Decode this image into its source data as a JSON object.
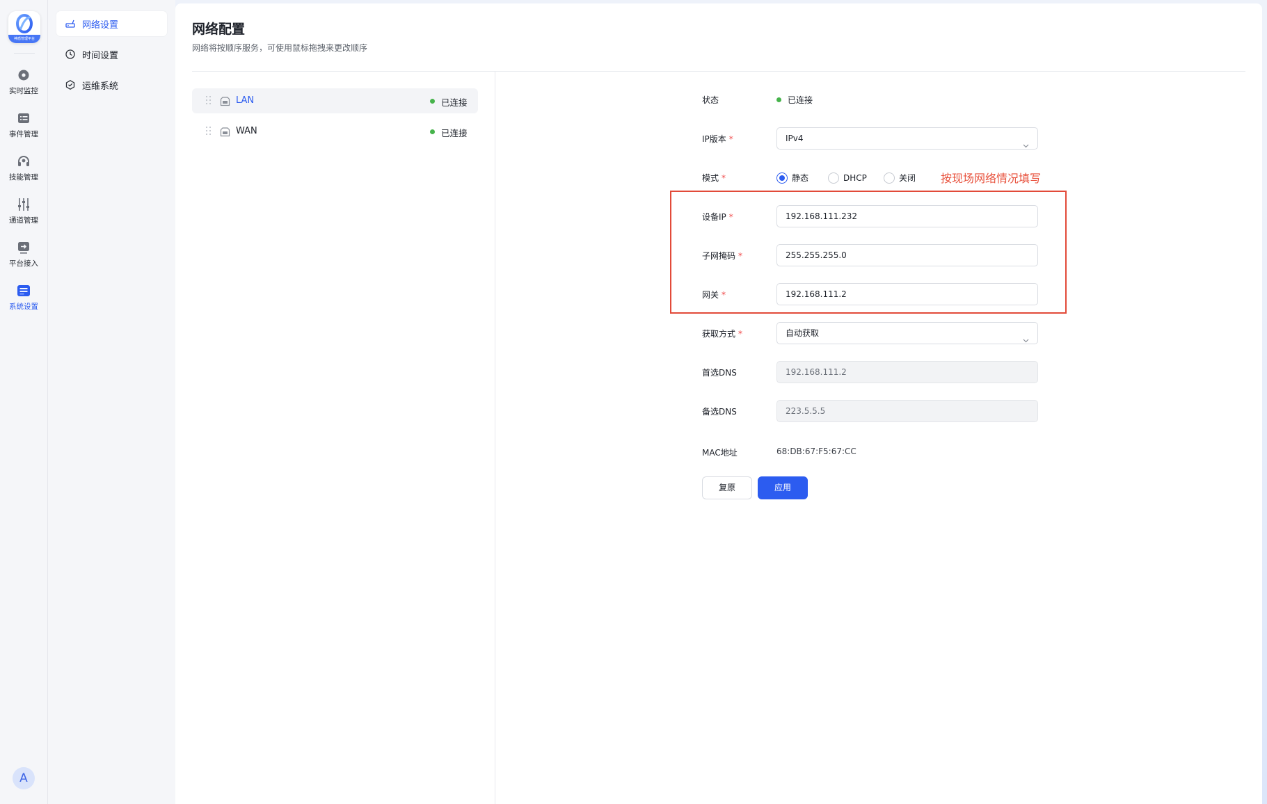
{
  "app": {
    "logo_text": "神盾管理平台"
  },
  "rail": {
    "items": [
      {
        "label": "实时监控",
        "icon": "monitor-eye-icon"
      },
      {
        "label": "事件管理",
        "icon": "event-list-icon"
      },
      {
        "label": "技能管理",
        "icon": "skill-headset-icon"
      },
      {
        "label": "通道管理",
        "icon": "channel-sliders-icon"
      },
      {
        "label": "平台接入",
        "icon": "platform-access-icon"
      },
      {
        "label": "系统设置",
        "icon": "system-settings-icon"
      }
    ],
    "active_index": 5,
    "avatar_letter": "A"
  },
  "submenu": {
    "items": [
      {
        "label": "网络设置",
        "icon": "router-icon"
      },
      {
        "label": "时间设置",
        "icon": "clock-icon"
      },
      {
        "label": "运维系统",
        "icon": "cube-icon"
      }
    ],
    "active_index": 0
  },
  "page": {
    "title": "网络配置",
    "subtitle": "网络将按顺序服务，可使用鼠标拖拽来更改顺序"
  },
  "networks": [
    {
      "name": "LAN",
      "status": "已连接"
    },
    {
      "name": "WAN",
      "status": "已连接"
    }
  ],
  "form": {
    "status_label": "状态",
    "status_value": "已连接",
    "ip_version_label": "IP版本",
    "ip_version_value": "IPv4",
    "mode_label": "模式",
    "mode_options": [
      "静态",
      "DHCP",
      "关闭"
    ],
    "mode_selected": "静态",
    "annotation": "按现场网络情况填写",
    "device_ip_label": "设备IP",
    "device_ip_value": "192.168.111.232",
    "subnet_label": "子网掩码",
    "subnet_value": "255.255.255.0",
    "gateway_label": "网关",
    "gateway_value": "192.168.111.2",
    "acquire_label": "获取方式",
    "acquire_value": "自动获取",
    "dns1_label": "首选DNS",
    "dns1_value": "192.168.111.2",
    "dns2_label": "备选DNS",
    "dns2_value": "223.5.5.5",
    "mac_label": "MAC地址",
    "mac_value": "68:DB:67:F5:67:CC",
    "reset_label": "复原",
    "apply_label": "应用",
    "required_mark": "*"
  },
  "colors": {
    "accent": "#2c5cf0",
    "connected": "#46b34b",
    "annotation": "#e24a39"
  }
}
